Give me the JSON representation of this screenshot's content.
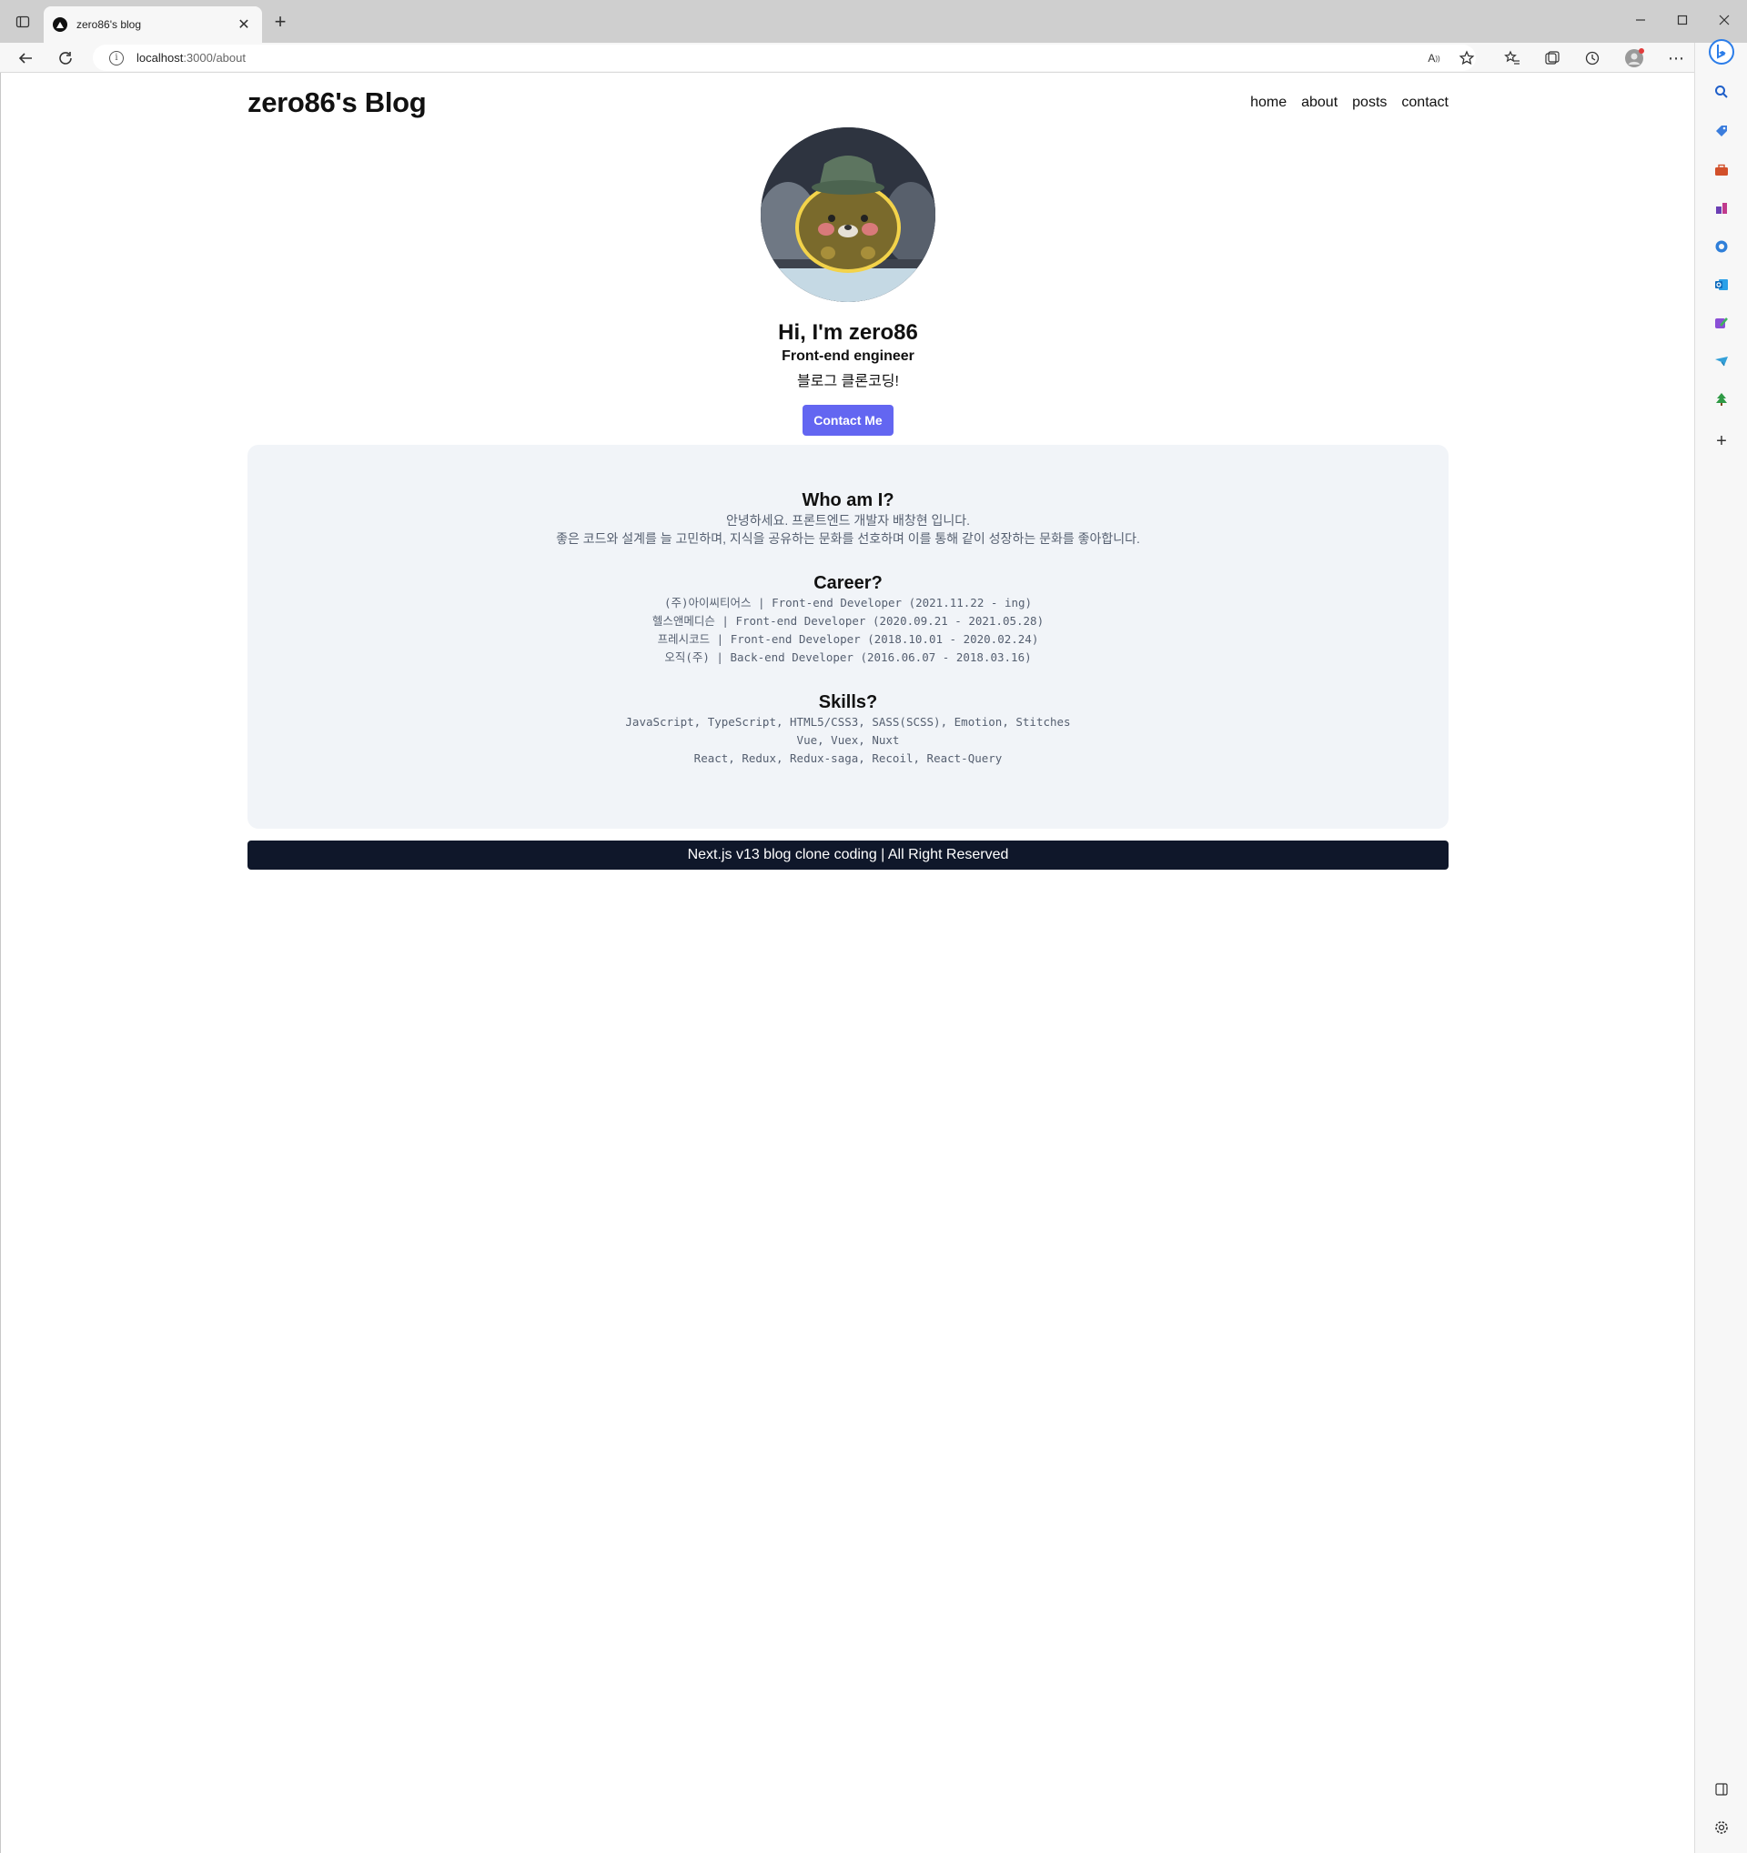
{
  "browser": {
    "tab_title": "zero86's blog",
    "url_host": "localhost",
    "url_path": ":3000/about"
  },
  "site": {
    "logo": "zero86's Blog",
    "nav": [
      "home",
      "about",
      "posts",
      "contact"
    ]
  },
  "hero": {
    "title": "Hi, I'm zero86",
    "subtitle": "Front-end engineer",
    "description": "블로그 클론코딩!",
    "button": "Contact Me"
  },
  "about": {
    "who": {
      "title": "Who am I?",
      "lines": [
        "안녕하세요. 프론트엔드 개발자 배창현 입니다.",
        "좋은 코드와 설계를 늘 고민하며, 지식을 공유하는 문화를 선호하며 이를 통해 같이 성장하는 문화를 좋아합니다."
      ]
    },
    "career": {
      "title": "Career?",
      "lines": [
        "(주)아이씨티어스 | Front-end Developer (2021.11.22 - ing)",
        "헬스앤메디슨 | Front-end Developer (2020.09.21 - 2021.05.28)",
        "프레시코드 | Front-end Developer (2018.10.01 - 2020.02.24)",
        "오직(주) | Back-end Developer (2016.06.07 - 2018.03.16)"
      ]
    },
    "skills": {
      "title": "Skills?",
      "lines": [
        "JavaScript, TypeScript, HTML5/CSS3, SASS(SCSS), Emotion, Stitches",
        "Vue, Vuex, Nuxt",
        "React, Redux, Redux-saga, Recoil, React-Query"
      ]
    }
  },
  "footer": {
    "text": "Next.js v13 blog clone coding | All Right Reserved"
  },
  "colors": {
    "accent": "#6366f1",
    "footer_bg": "#0f172a",
    "panel_bg": "#f1f4f8"
  }
}
